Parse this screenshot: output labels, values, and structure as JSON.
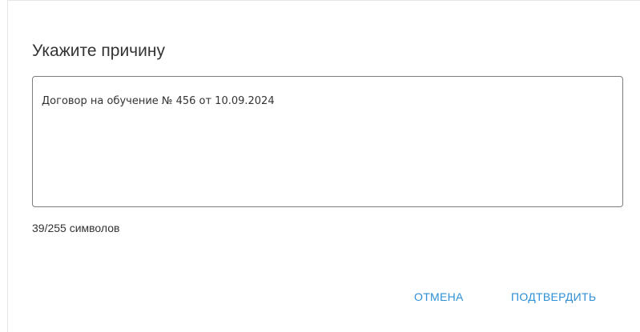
{
  "dialog": {
    "title": "Укажите причину",
    "reason": {
      "value": "Договор на обучение № 456 от 10.09.2024"
    },
    "counter": "39/255 символов",
    "buttons": {
      "cancel": "ОТМЕНА",
      "confirm": "ПОДТВЕРДИТЬ"
    },
    "accent_color": "#2d8fd6"
  }
}
